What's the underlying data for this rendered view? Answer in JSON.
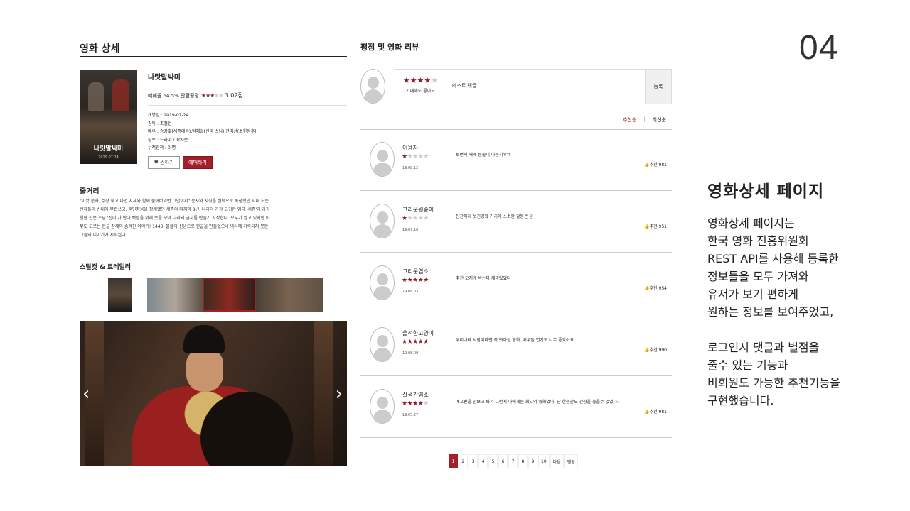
{
  "slide_number": "04",
  "detail": {
    "title": "영화 상세",
    "poster_title": "나랏말싸미",
    "poster_sub": "2019.07.24",
    "movie_name": "나랏말싸미",
    "rating": {
      "prefix": "예매율 64.5% 관람평점",
      "stars": "★★★",
      "stars_off": "★★",
      "score": "3.02점"
    },
    "meta": [
      "개봉일 : 2019-07-24",
      "감독 : 조철현",
      "배우 : 송강호(세종대왕),박해일(신미 스님),전미선(소헌왕후)",
      "장르 : 드라마 / 109분",
      "누적관객 : 0 명"
    ],
    "like_button": "♥ 찜하기",
    "book_button": "예매하기",
    "synopsis_heading": "줄거리",
    "synopsis": "\"이깟 문자, 주상 죽고 나면 시체와 함께 묻어버리면 그만이지\" 문자와 지식을 권력으로 독점했던 시대 모든 신하들의 반대에 무릅쓰고, 훈민정음을 창제했던 세종의 마지막 8년. 나라의 가장 고귀한 임금 '세종'과 가장 천한 신분 스님 '신미'가 만나 백성을 위해 뜻을 모아 나라의 글자를 만들기 시작한다. 모두가 알고 있지만 아무도 모르는 한글 창제의 숨겨진 이야기! 1443, 불굴의 신념으로 한글을 만들었으나 역사에 기록되지 못한 그들의 이야기가 시작된다.",
    "stills_heading": "스틸컷 & 트레일러"
  },
  "reviews": {
    "title": "평점 및 영화 리뷰",
    "write": {
      "stars": "★★★★",
      "stars_off": "★",
      "hint": "기대해도 좋아요",
      "text": "테스트 댓글",
      "submit": "등록"
    },
    "sort_recommend": "추천순",
    "sort_separator": "|",
    "sort_latest": "최신순",
    "items": [
      {
        "user": "이용자",
        "stars": "★",
        "stars_off": "★★★★",
        "date": "19.08.12",
        "text": "보면서 왜케 눈물이 나는지ㅠㅠ",
        "likes": "추천 981"
      },
      {
        "user": "그리운원숭이",
        "stars": "★",
        "stars_off": "★★★★",
        "date": "19.07.10",
        "text": "잔잔하게 웃긴영화 거기에 소소한 감동은 덤",
        "likes": "추천 951"
      },
      {
        "user": "그리운염소",
        "stars": "★★★★★",
        "stars_off": "",
        "date": "19.08.03",
        "text": "추천 오지게 박는다 재미있었다",
        "likes": "추천 954"
      },
      {
        "user": "울적한고양이",
        "stars": "★★★★★",
        "stars_off": "",
        "date": "19.08.09",
        "text": "우리나라 사람이라면 꼭 봐야될 영화. 배우들 연기도 너무 좋았어요",
        "likes": "추천 990"
      },
      {
        "user": "잘생긴염소",
        "stars": "★★★★",
        "stars_off": "★",
        "date": "19.05.27",
        "text": "예고편을 안보고 봐서 그런지 나에게는 최고의 영화였다. 단 한순간도 긴장을 놓을수 없었다.",
        "likes": "추천 981"
      }
    ],
    "pagination": [
      "1",
      "2",
      "3",
      "4",
      "5",
      "6",
      "7",
      "8",
      "9",
      "10",
      "다음",
      "맨끝"
    ],
    "active_page": "1"
  },
  "description": {
    "heading": "영화상세 페이지",
    "lines1": [
      "영화상세 페이지는",
      "한국 영화 진흥위원회",
      "REST API를 사용해 등록한",
      "정보들을 모두 가져와",
      "유저가 보기 편하게",
      "원하는 정보를 보여주었고,"
    ],
    "lines2": [
      "로그인시 댓글과 별점을",
      "줄수 있는 기능과",
      "비회원도 가능한 추천기능을",
      "구현했습니다."
    ]
  },
  "colors": {
    "accent": "#a3202b",
    "star": "#8e1f2a",
    "star_off": "#cccccc"
  }
}
